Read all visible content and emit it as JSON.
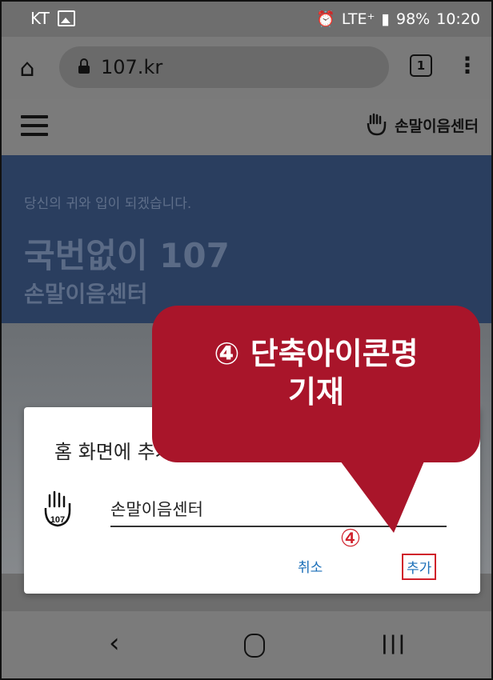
{
  "status_bar": {
    "carrier": "KT",
    "right_indicators": "LTE⁺",
    "battery": "98%",
    "time": "10:20"
  },
  "browser": {
    "url": "107.kr",
    "tab_count": "1"
  },
  "site": {
    "logo_text": "손말이음센터"
  },
  "hero": {
    "subtitle": "당신의 귀와 입이 되겠습니다.",
    "title": "국번없이 107",
    "title2": "손말이음센터"
  },
  "dialog": {
    "title": "홈 화면에 추가",
    "name_value": "손말이음센터",
    "cancel_label": "취소",
    "add_label": "추가"
  },
  "annotation": {
    "callout_line1": "④ 단축아이콘명",
    "callout_line2": "기재",
    "step_number": "④"
  },
  "colors": {
    "callout": "#a9152a",
    "highlight": "#d01f2a",
    "button_text": "#1a6eb8"
  }
}
